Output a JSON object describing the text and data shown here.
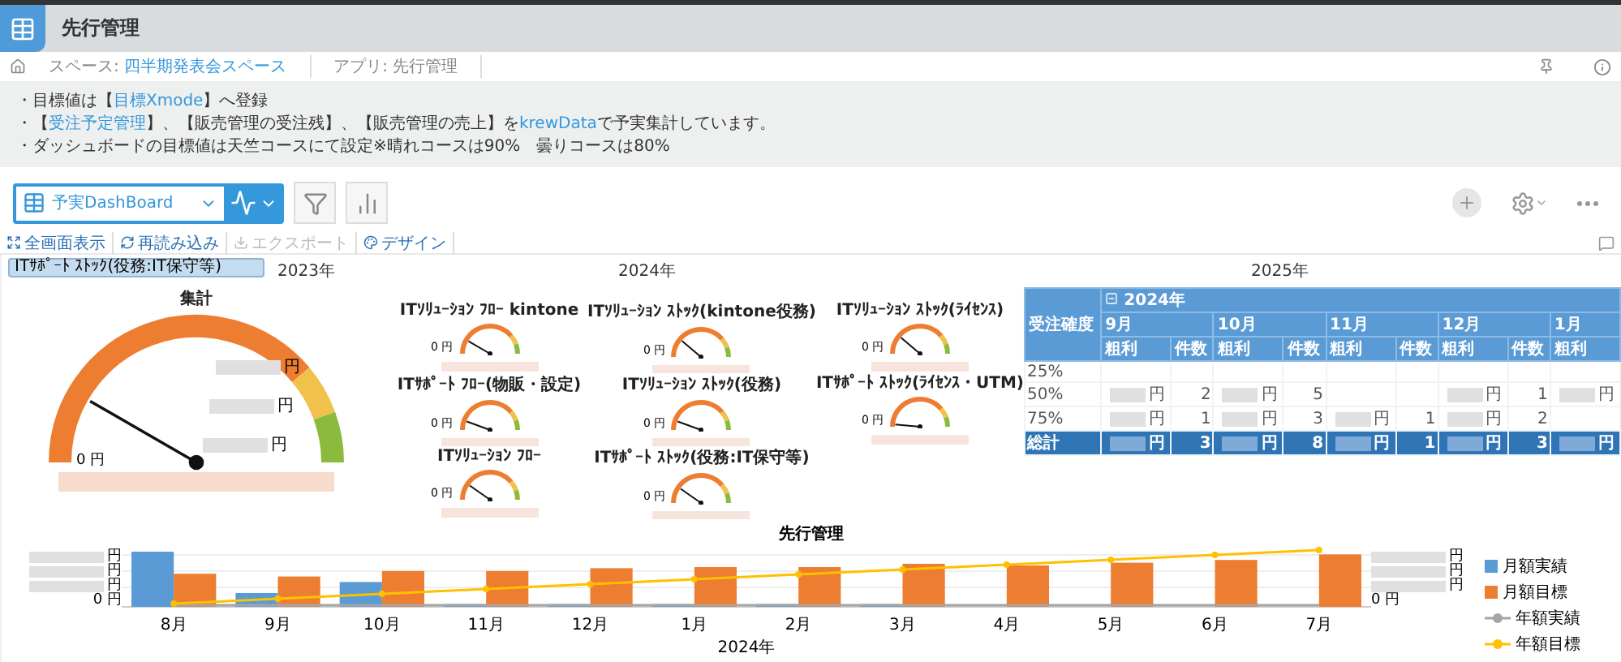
{
  "app": {
    "title": "先行管理"
  },
  "breadcrumb": [
    {
      "kind": "home"
    },
    {
      "kind": "crumb",
      "parts": [
        {
          "text": "スペース: ",
          "kind": "plain"
        },
        {
          "text": "四半期発表会スペース",
          "kind": "link"
        }
      ]
    },
    {
      "kind": "crumb",
      "parts": [
        {
          "text": "アプリ: 先行管理",
          "kind": "plain"
        }
      ]
    }
  ],
  "description": [
    [
      {
        "text": "・目標値は【",
        "kind": "plain"
      },
      {
        "text": "目標Xmode",
        "kind": "link"
      },
      {
        "text": "】へ登録",
        "kind": "plain"
      }
    ],
    [
      {
        "text": "・【",
        "kind": "plain"
      },
      {
        "text": "受注予定管理",
        "kind": "link"
      },
      {
        "text": "】、【販売管理の受注残】、【販売管理の売上】を",
        "kind": "plain"
      },
      {
        "text": "krewData",
        "kind": "link"
      },
      {
        "text": "で予実集計しています。",
        "kind": "plain"
      }
    ],
    [
      {
        "text": "・ダッシュボードの目標値は天竺コースにて設定※晴れコースは90%　曇りコースは80%",
        "kind": "plain"
      }
    ]
  ],
  "toolbar": {
    "view": "予実DashBoard"
  },
  "dashboard_actions": [
    {
      "label": "全画面表示",
      "kind": "fullscreen",
      "disabled": false
    },
    {
      "label": "再読み込み",
      "kind": "reload",
      "disabled": false
    },
    {
      "label": "エクスポート",
      "kind": "export",
      "disabled": true
    },
    {
      "label": "デザイン",
      "kind": "design",
      "disabled": false
    }
  ],
  "timeline": [
    "2023年",
    "2024年",
    "2025年"
  ],
  "filters": [
    {
      "label": "ITｻﾎﾟｰﾄ ｽﾄｯｸ(役務:IT保守等)"
    }
  ],
  "main_gauge": {
    "title": "集計",
    "zero_label": "0 円",
    "tick_labels": [
      "円",
      "円",
      "円"
    ]
  },
  "gauges": [
    {
      "title": "ITｿﾘｭｰｼｮﾝ ﾌﾛｰ kintone",
      "zero_label": "0 円"
    },
    {
      "title": "ITｿﾘｭｰｼｮﾝ ｽﾄｯｸ(kintone役務)",
      "zero_label": "0 円"
    },
    {
      "title": "ITｿﾘｭｰｼｮﾝ ｽﾄｯｸ(ﾗｲｾﾝｽ)",
      "zero_label": "0 円"
    },
    {
      "title": "ITｻﾎﾟｰﾄ ﾌﾛｰ(物販・設定)",
      "zero_label": "0 円"
    },
    {
      "title": "ITｿﾘｭｰｼｮﾝ ｽﾄｯｸ(役務)",
      "zero_label": "0 円"
    },
    {
      "title": "ITｻﾎﾟｰﾄ ｽﾄｯｸ(ﾗｲｾﾝｽ・UTM)",
      "zero_label": "0 円"
    },
    {
      "title": "ITｿﾘｭｰｼｮﾝ ﾌﾛｰ",
      "zero_label": "0 円"
    },
    {
      "title": "ITｻﾎﾟｰﾄ ｽﾄｯｸ(役務:IT保守等)",
      "zero_label": "0 円"
    }
  ],
  "pivot": {
    "row_header": "受注確度",
    "year": "2024年",
    "columns": [
      {
        "month": "9月",
        "measures": [
          "粗利",
          "件数"
        ]
      },
      {
        "month": "10月",
        "measures": [
          "粗利",
          "件数"
        ]
      },
      {
        "month": "11月",
        "measures": [
          "粗利",
          "件数"
        ]
      },
      {
        "month": "12月",
        "measures": [
          "粗利",
          "件数"
        ]
      },
      {
        "month": "1月",
        "measures": [
          "粗利"
        ]
      }
    ],
    "rows": [
      {
        "label": "25%",
        "total": false,
        "cells": [
          {},
          {},
          {},
          {},
          {}
        ]
      },
      {
        "label": "50%",
        "total": false,
        "cells": [
          {
            "amount": "円",
            "count": "2"
          },
          {
            "amount": "円",
            "count": "5"
          },
          {},
          {
            "amount": "円",
            "count": "1"
          },
          {
            "amount": "円"
          }
        ]
      },
      {
        "label": "75%",
        "total": false,
        "cells": [
          {
            "amount": "円",
            "count": "1"
          },
          {
            "amount": "円",
            "count": "3"
          },
          {
            "amount": "円",
            "count": "1"
          },
          {
            "amount": "円",
            "count": "2"
          },
          {}
        ]
      },
      {
        "label": "総計",
        "total": true,
        "cells": [
          {
            "amount": "円",
            "count": "3"
          },
          {
            "amount": "円",
            "count": "8"
          },
          {
            "amount": "円",
            "count": "1"
          },
          {
            "amount": "円",
            "count": "3"
          },
          {
            "amount": "円"
          }
        ]
      }
    ]
  },
  "combo_chart": {
    "title": "先行管理",
    "y_left": [
      "円",
      "円",
      "円",
      "0 円"
    ],
    "y_right": [
      "円",
      "円",
      "円",
      "0 円"
    ],
    "x_labels": [
      "8月",
      "9月",
      "10月",
      "11月",
      "12月",
      "1月",
      "2月",
      "3月",
      "4月",
      "5月",
      "6月",
      "7月"
    ],
    "xlabel": "2024年",
    "legend": [
      {
        "label": "月額実績",
        "kind": "bar",
        "color": "#5b9bd5"
      },
      {
        "label": "月額目標",
        "kind": "bar",
        "color": "#ed7d31"
      },
      {
        "label": "年額実績",
        "kind": "line",
        "color": "#a5a5a5"
      },
      {
        "label": "年額目標",
        "kind": "line",
        "color": "#ffc000"
      }
    ]
  }
}
